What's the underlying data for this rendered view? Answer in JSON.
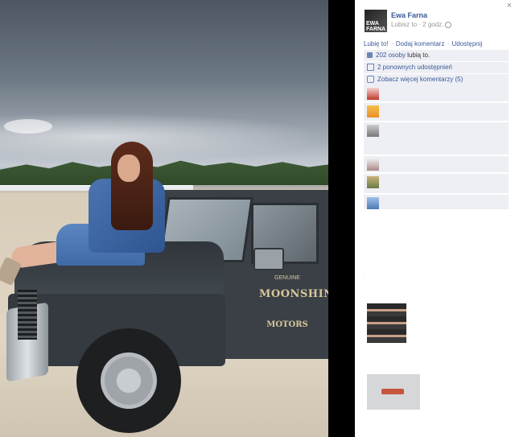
{
  "post": {
    "poster_name": "Ewa Farna",
    "avatar_text": "EWA FARNA",
    "like_label": "Lubisz to",
    "meta_sep": " · ",
    "time_ago": "2 godz.",
    "close_glyph": "×"
  },
  "actions": {
    "like": "Lubię to!",
    "comment": "Dodaj komentarz",
    "share": "Udostępnij",
    "separator": "·"
  },
  "stats": {
    "likes_count": "202 osoby",
    "likes_suffix": "lubią to.",
    "shares": "2 ponownych udostępnień",
    "more_comments": "Zobacz więcej komentarzy (5)"
  },
  "photo": {
    "logo_top": "GENUINE",
    "logo_main": "MOONSHINE",
    "logo_bottom": "MOTORS"
  },
  "colors": {
    "link": "#3b5998",
    "row_bg": "#edeff4",
    "meta_gray": "#999999"
  },
  "icons": [
    "close-icon",
    "globe-icon",
    "like-icon",
    "share-icon",
    "comment-icon"
  ]
}
